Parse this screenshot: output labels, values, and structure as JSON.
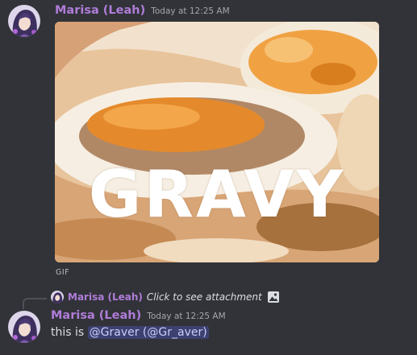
{
  "message1": {
    "author": "Marisa (Leah)",
    "timestamp": "Today at 12:25 AM",
    "gif": {
      "word": "GRAVY",
      "badge": "GIF"
    }
  },
  "reply": {
    "author": "Marisa (Leah)",
    "text": "Click to see attachment",
    "icon": "image-icon"
  },
  "message2": {
    "author": "Marisa (Leah)",
    "timestamp": "Today at 12:25 AM",
    "text_prefix": "this is ",
    "mention": "@Graver (@Gr_aver)"
  },
  "colors": {
    "background": "#313338",
    "username": "#b07cd8",
    "timestamp": "#a3a6aa",
    "message_text": "#dbdee1",
    "mention_bg": "#5865f2"
  }
}
